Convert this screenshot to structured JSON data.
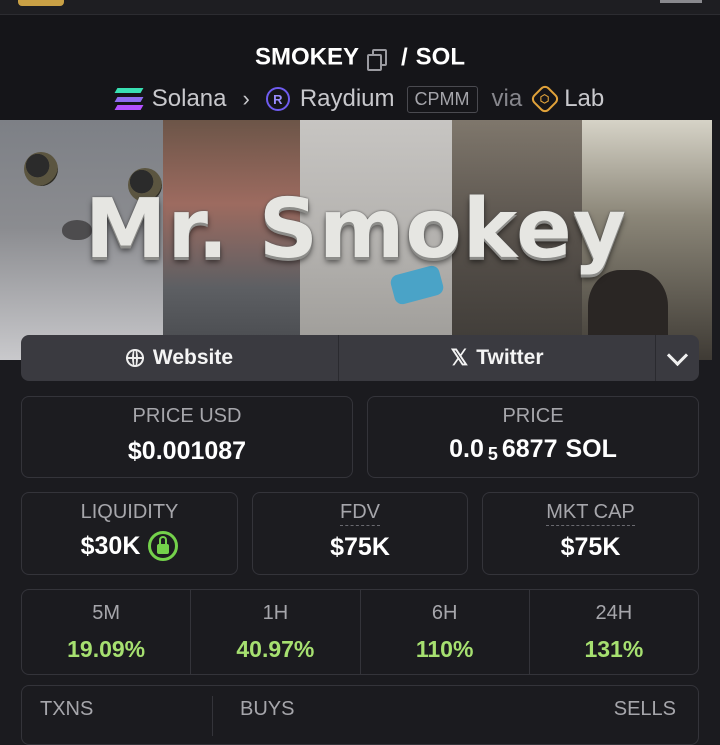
{
  "header": {
    "token_symbol": "SMOKEY",
    "separator": "/",
    "quote_symbol": "SOL",
    "chain": "Solana",
    "dex": "Raydium",
    "pool_type": "CPMM",
    "via_text": "via",
    "via_source": "Lab"
  },
  "banner": {
    "title": "Mr. Smokey"
  },
  "links": {
    "website_label": "Website",
    "twitter_label": "Twitter"
  },
  "stats": {
    "price_usd": {
      "label": "PRICE USD",
      "value": "$0.001087"
    },
    "price_native": {
      "label": "PRICE",
      "prefix": "0.0",
      "zero_subscript": "5",
      "digits": "6877",
      "unit": "SOL"
    },
    "liquidity": {
      "label": "LIQUIDITY",
      "value": "$30K",
      "locked": true
    },
    "fdv": {
      "label": "FDV",
      "value": "$75K"
    },
    "mkt_cap": {
      "label": "MKT CAP",
      "value": "$75K"
    }
  },
  "changes": [
    {
      "label": "5M",
      "value": "19.09%"
    },
    {
      "label": "1H",
      "value": "40.97%"
    },
    {
      "label": "6H",
      "value": "110%"
    },
    {
      "label": "24H",
      "value": "131%"
    }
  ],
  "txns": {
    "txns_label": "TXNS",
    "buys_label": "BUYS",
    "sells_label": "SELLS"
  },
  "colors": {
    "background": "#1b1b1f",
    "positive": "#a6e070",
    "lock": "#74d14b",
    "solana_green": "#39e0b3",
    "raydium_purple": "#6f5cf0",
    "lab_orange": "#e0a23a"
  }
}
